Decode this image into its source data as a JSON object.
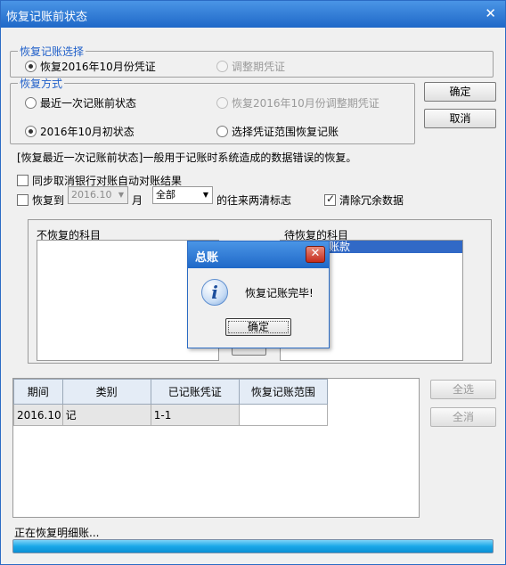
{
  "window": {
    "title": "恢复记账前状态",
    "close": "✕"
  },
  "group_select": {
    "legend": "恢复记账选择",
    "opt1": "恢复2016年10月份凭证",
    "opt2": "调整期凭证"
  },
  "group_method": {
    "legend": "恢复方式",
    "opt1": "最近一次记账前状态",
    "opt2": "恢复2016年10月份调整期凭证",
    "opt3": "2016年10月初状态",
    "opt4": "选择凭证范围恢复记账"
  },
  "buttons": {
    "ok": "确定",
    "cancel": "取消",
    "select_all": "全选",
    "deselect_all": "全消"
  },
  "description": "[恢复最近一次记账前状态]一般用于记账时系统造成的数据错误的恢复。",
  "options": {
    "sync_bank": "同步取消银行对账自动对账结果",
    "restore_to": "恢复到",
    "period_value": "2016.10",
    "month_unit": "月",
    "scope_value": "全部",
    "scope_suffix": "的往来两清标志",
    "clear_redundant": "清除冗余数据"
  },
  "lists": {
    "left_title": "不恢复的科目",
    "right_title": "待恢复的科目",
    "right_selected_item": "账款"
  },
  "table": {
    "headers": [
      "期间",
      "类别",
      "已记账凭证",
      "恢复记账范围"
    ],
    "rows": [
      [
        "2016.10",
        "记",
        "1-1",
        ""
      ]
    ]
  },
  "status": {
    "text": "正在恢复明细账...",
    "progress": 1.0
  },
  "dialog": {
    "title": "总账",
    "close": "✕",
    "icon": "info-icon",
    "message": "恢复记账完毕!",
    "ok": "确定"
  }
}
